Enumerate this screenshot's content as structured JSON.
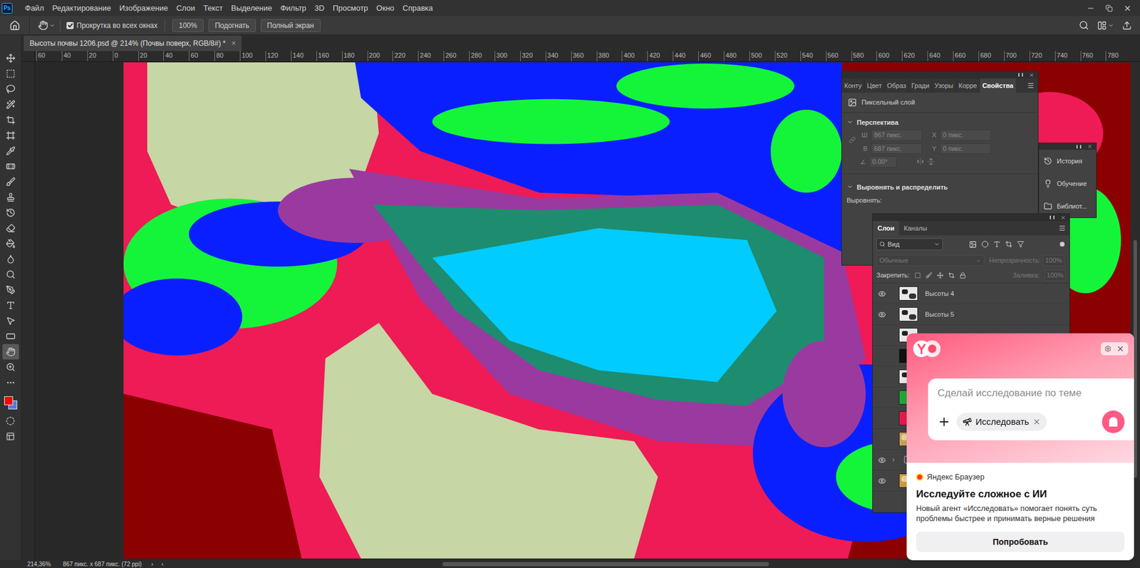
{
  "app": {
    "logo": "Ps",
    "menu": [
      "Файл",
      "Редактирование",
      "Изображение",
      "Слои",
      "Текст",
      "Выделение",
      "Фильтр",
      "3D",
      "Просмотр",
      "Окно",
      "Справка"
    ]
  },
  "options": {
    "scroll_all": {
      "label": "Прокрутка во всех окнах",
      "checked": true
    },
    "zoom": "100%",
    "buttons": [
      "Подогнать",
      "Полный экран"
    ]
  },
  "tools": [
    {
      "kind": "move",
      "selected": false
    },
    {
      "kind": "marquee",
      "selected": false
    },
    {
      "kind": "lasso",
      "selected": false
    },
    {
      "kind": "quickselect",
      "selected": false
    },
    {
      "kind": "crop",
      "selected": false
    },
    {
      "kind": "frame",
      "selected": false
    },
    {
      "kind": "eyedropper",
      "selected": false
    },
    {
      "kind": "healing",
      "selected": false
    },
    {
      "kind": "brush",
      "selected": false
    },
    {
      "kind": "stamp",
      "selected": false
    },
    {
      "kind": "history",
      "selected": false
    },
    {
      "kind": "eraser",
      "selected": false
    },
    {
      "kind": "gradient",
      "selected": false
    },
    {
      "kind": "blur",
      "selected": false
    },
    {
      "kind": "dodge",
      "selected": false
    },
    {
      "kind": "pen",
      "selected": false
    },
    {
      "kind": "type",
      "selected": false
    },
    {
      "kind": "path",
      "selected": false
    },
    {
      "kind": "shape",
      "selected": false
    },
    {
      "kind": "hand",
      "selected": true
    },
    {
      "kind": "zoom",
      "selected": false
    },
    {
      "kind": "more",
      "selected": false
    }
  ],
  "swatches": [
    {
      "kind": "foreground",
      "color": "#ff0000"
    },
    {
      "kind": "background",
      "color": "#4f7fe0"
    }
  ],
  "document_tab": {
    "title": "Высоты почвы 1206.psd @ 214% (Почвы поверх, RGB/8#) *",
    "close": "×",
    "selected": true
  },
  "ruler": {
    "labels": [
      "60",
      "40",
      "20",
      "0",
      "20",
      "40",
      "60",
      "80",
      "100",
      "120",
      "140",
      "160",
      "180",
      "200",
      "220",
      "240",
      "260",
      "280",
      "300",
      "320",
      "340",
      "360",
      "380",
      "400",
      "420",
      "440",
      "460",
      "480",
      "500",
      "520",
      "540",
      "560",
      "580",
      "600",
      "620",
      "640",
      "660",
      "680",
      "700",
      "720",
      "740",
      "760",
      "780"
    ]
  },
  "properties_panel": {
    "tabs": [
      {
        "label": "Конту",
        "selected": false
      },
      {
        "label": "Цвет",
        "selected": false
      },
      {
        "label": "Образ",
        "selected": false
      },
      {
        "label": "Гради",
        "selected": false
      },
      {
        "label": "Узоры",
        "selected": false
      },
      {
        "label": "Корре",
        "selected": false
      },
      {
        "label": "Свойства",
        "selected": true
      }
    ],
    "layer_kind": "Пиксельный слой",
    "perspective": {
      "title": "Перспектива",
      "expanded": true,
      "fields": [
        {
          "label": "Ш",
          "value": "867 пикс."
        },
        {
          "label": "X",
          "value": "0 пикс."
        },
        {
          "label": "В",
          "value": "687 пикс."
        },
        {
          "label": "Y",
          "value": "0 пикс."
        }
      ],
      "angle": "0.00°"
    },
    "align": {
      "title": "Выровнять и распределить",
      "expanded": true,
      "label": "Выровнять:"
    }
  },
  "side_panel": {
    "items": [
      "История",
      "Обучение",
      "Библиот..."
    ]
  },
  "layers_panel": {
    "tabs": [
      {
        "label": "Слои",
        "selected": true
      },
      {
        "label": "Каналы",
        "selected": false
      }
    ],
    "filter": "Вид",
    "blend": "Обычные",
    "opacity_label": "Непрозрачность:",
    "opacity": "100%",
    "lock_label": "Закрепить:",
    "fill_label": "Заливка:",
    "fill": "100%",
    "layers": [
      {
        "name": "Высоты 4",
        "visible": true,
        "kind": "pattern",
        "color": "#e8e8e8"
      },
      {
        "name": "Высоты 5",
        "visible": true,
        "kind": "pattern",
        "color": "#e8e8e8"
      },
      {
        "name": "",
        "visible": false,
        "kind": "pattern",
        "color": "#e8e8e8"
      },
      {
        "name": "",
        "visible": false,
        "kind": "solid",
        "color": "#111111"
      },
      {
        "name": "",
        "visible": false,
        "kind": "pattern",
        "color": "#e8e8e8"
      },
      {
        "name": "",
        "visible": false,
        "kind": "solid",
        "color": "#22a83a"
      },
      {
        "name": "",
        "visible": false,
        "kind": "solid",
        "color": "#e8184f"
      },
      {
        "name": "",
        "visible": false,
        "kind": "map",
        "color": "#c9a15a"
      },
      {
        "name": "",
        "visible": true,
        "kind": "folder",
        "color": "#9a9a9a"
      },
      {
        "name": "",
        "visible": true,
        "kind": "map",
        "color": "#d09a40"
      }
    ]
  },
  "popup": {
    "input_placeholder": "Сделай исследование по теме",
    "chip": "Исследовать",
    "brand": "Яндекс Браузер",
    "title": "Исследуйте сложное с ИИ",
    "text": "Новый агент «Исследовать» помогает понять суть проблемы быстрее и принимать верные решения",
    "button": "Попробовать"
  },
  "status": {
    "zoom": "214,36%",
    "info": "867 пикс. x 687 пикс. (72 ppi)",
    "nav": [
      "›",
      "‹"
    ]
  }
}
